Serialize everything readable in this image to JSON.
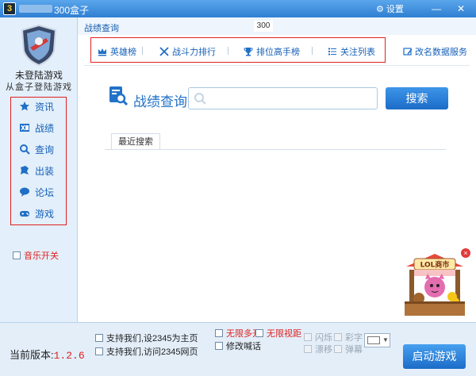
{
  "window": {
    "logo_text": "3",
    "title": "300盒子",
    "settings_label": "⚙ 设置",
    "minimize_glyph": "—",
    "close_glyph": "✕"
  },
  "sidebar": {
    "login_status": "未登陆游戏",
    "login_hint": "从盒子登陆游戏",
    "items": [
      {
        "label": "资讯",
        "icon": "star-icon"
      },
      {
        "label": "战绩",
        "icon": "excel-icon"
      },
      {
        "label": "查询",
        "icon": "search-icon"
      },
      {
        "label": "出装",
        "icon": "equipment-icon"
      },
      {
        "label": "论坛",
        "icon": "chat-bubble-icon"
      },
      {
        "label": "游戏",
        "icon": "gamepad-icon"
      }
    ],
    "music_toggle": "音乐开关"
  },
  "content": {
    "breadcrumb": "战绩查询",
    "count_badge": "300",
    "tabs": [
      {
        "label": "英雄榜",
        "icon": "crown-icon"
      },
      {
        "label": "战斗力排行",
        "icon": "crossed-swords-icon"
      },
      {
        "label": "排位高手榜",
        "icon": "trophy-icon"
      },
      {
        "label": "关注列表",
        "icon": "list-icon"
      }
    ],
    "service_link": "改名数据服务",
    "search_title": "战绩查询",
    "search_placeholder": "",
    "search_button": "搜索",
    "recent_tab": "最近搜索"
  },
  "ad": {
    "close_glyph": "×",
    "sign_text": "LOL商市"
  },
  "bottom": {
    "version_label": "当前版本:",
    "version_value": "1.2.6",
    "support_home": "支持我们,设2345为主页",
    "support_visit": "支持我们,访问2345网页",
    "unlimited_multi": "无限多开",
    "unlimited_view": "无限视距",
    "modify_shout": "修改喊话",
    "flash": "闪烁",
    "color_text": "彩字",
    "scroll": "漂移",
    "barrage": "弹幕",
    "launch_button": "启动游戏"
  },
  "colors": {
    "accent": "#2272c8",
    "highlight_border": "#e02020",
    "titlebar": "#3a8ad8"
  }
}
